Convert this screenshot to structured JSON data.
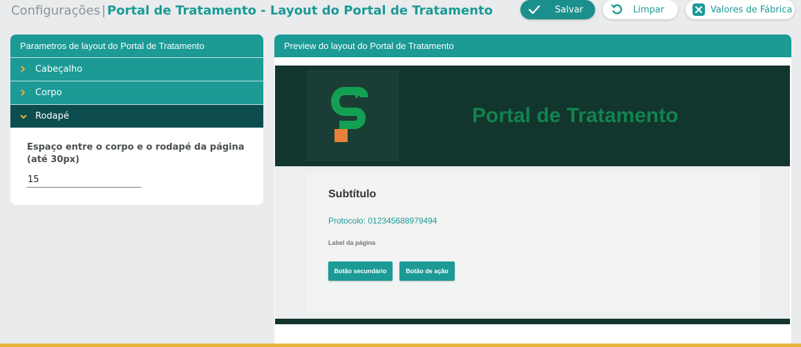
{
  "header": {
    "breadcrumb_root": "Configurações",
    "separator": "|",
    "title": "Portal de Tratamento - Layout do Portal de Tratamento",
    "save_label": "Salvar",
    "clear_label": "Limpar",
    "factory_label": "Valores de Fábrica",
    "save_icon": "check-icon",
    "clear_icon": "undo-icon",
    "factory_icon": "close-box-icon"
  },
  "left_panel": {
    "title": "Parametros de layout do Portal de Tratamento",
    "sections": [
      {
        "label": "Cabeçalho",
        "expanded": false
      },
      {
        "label": "Corpo",
        "expanded": false
      },
      {
        "label": "Rodapé",
        "expanded": true
      }
    ],
    "footer_spacing": {
      "label": "Espaço entre o corpo e o rodapé da página (até 30px)",
      "value": "15"
    }
  },
  "preview": {
    "title": "Preview do layout do Portal de Tratamento",
    "portal_title": "Portal de Tratamento",
    "subtitle": "Subtítulo",
    "protocol": "Protocolo: 012345688979494",
    "page_label": "Label da página",
    "secondary_button": "Botão secundário",
    "action_button": "Botão de ação"
  },
  "colors": {
    "accent": "#1b9a96",
    "dark_accent": "#0d4d50",
    "preview_header": "#12352d",
    "portal_title": "#12834f",
    "logo_square": "#e8823a",
    "chevron": "#f2b233"
  }
}
